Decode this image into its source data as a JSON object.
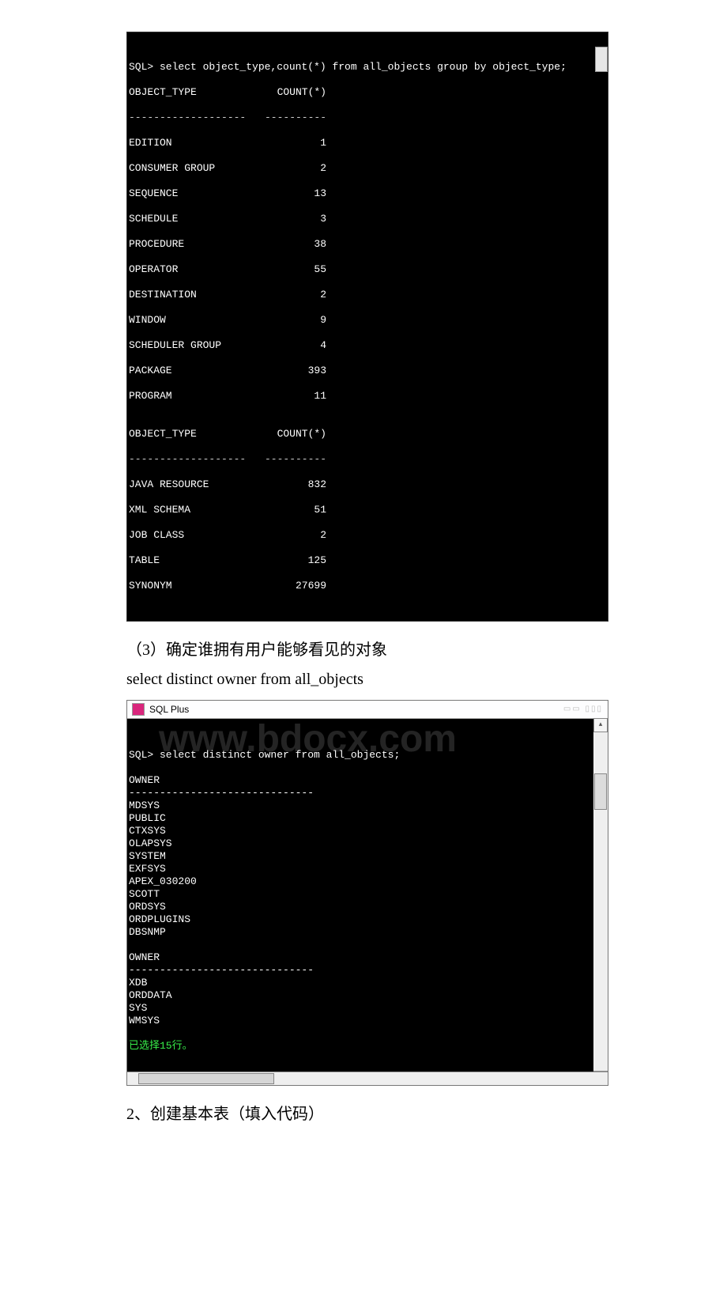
{
  "terminal1": {
    "sql_line": "SQL> select object_type,count(*) from all_objects group by object_type;",
    "header_col1": "OBJECT_TYPE",
    "header_col2": "COUNT(*)",
    "dash_col1": "-------------------",
    "dash_col2": "----------",
    "block1": [
      {
        "object_type": "EDITION",
        "count": "1"
      },
      {
        "object_type": "CONSUMER GROUP",
        "count": "2"
      },
      {
        "object_type": "SEQUENCE",
        "count": "13"
      },
      {
        "object_type": "SCHEDULE",
        "count": "3"
      },
      {
        "object_type": "PROCEDURE",
        "count": "38"
      },
      {
        "object_type": "OPERATOR",
        "count": "55"
      },
      {
        "object_type": "DESTINATION",
        "count": "2"
      },
      {
        "object_type": "WINDOW",
        "count": "9"
      },
      {
        "object_type": "SCHEDULER GROUP",
        "count": "4"
      },
      {
        "object_type": "PACKAGE",
        "count": "393"
      },
      {
        "object_type": "PROGRAM",
        "count": "11"
      }
    ],
    "block2": [
      {
        "object_type": "JAVA RESOURCE",
        "count": "832"
      },
      {
        "object_type": "XML SCHEMA",
        "count": "51"
      },
      {
        "object_type": "JOB CLASS",
        "count": "2"
      },
      {
        "object_type": "TABLE",
        "count": "125"
      },
      {
        "object_type": "SYNONYM",
        "count": "27699"
      }
    ]
  },
  "text1": "（3）确定谁拥有用户能够看见的对象",
  "query1": "select distinct owner from all_objects",
  "window2": {
    "title": "SQL Plus",
    "controls": "▭▭  ▯▯▯",
    "watermark": "www.bdocx.com",
    "sql_line": "SQL> select distinct owner from all_objects;",
    "header": "OWNER",
    "dash": "------------------------------",
    "block1": [
      "MDSYS",
      "PUBLIC",
      "CTXSYS",
      "OLAPSYS",
      "SYSTEM",
      "EXFSYS",
      "APEX_030200",
      "SCOTT",
      "ORDSYS",
      "ORDPLUGINS",
      "DBSNMP"
    ],
    "block2": [
      "XDB",
      "ORDDATA",
      "SYS",
      "WMSYS"
    ],
    "footer": "已选择15行。"
  },
  "text2": "2、创建基本表（填入代码）"
}
